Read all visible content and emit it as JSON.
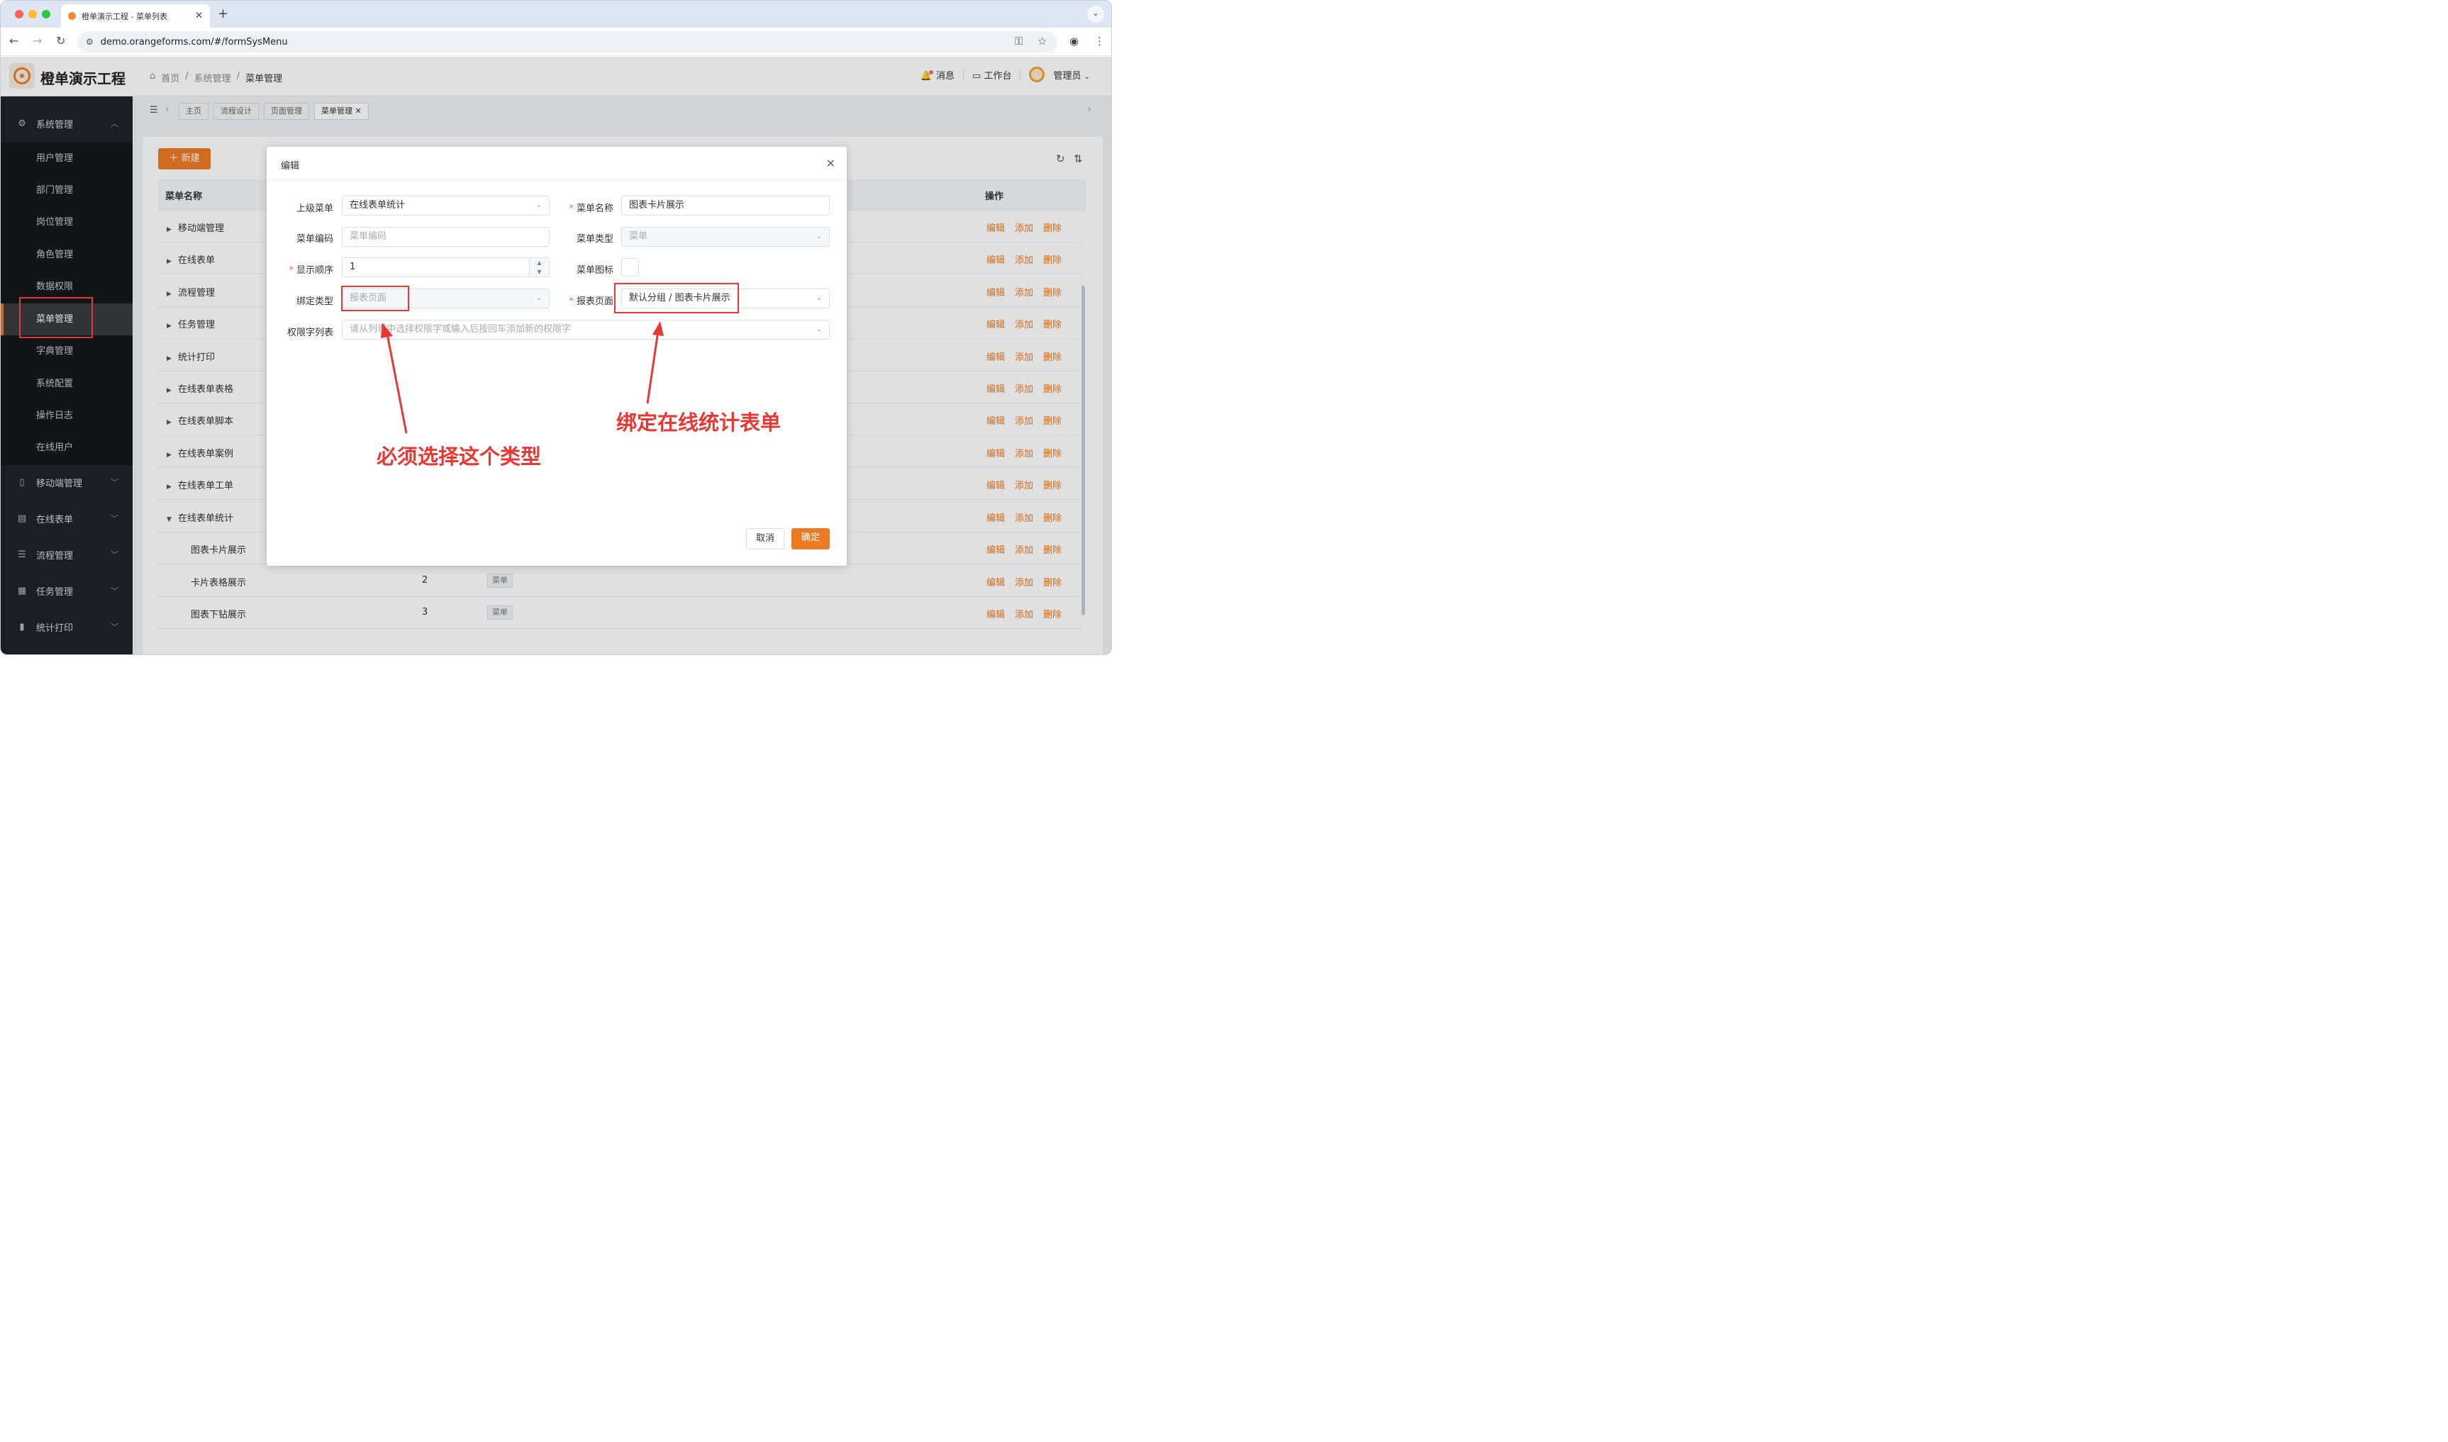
{
  "browser": {
    "tab_title": "橙单演示工程 - 菜单列表",
    "new_tab": "+",
    "url": "demo.orangeforms.com/#/formSysMenu",
    "traffic_colors": [
      "#ff5f57",
      "#febc2e",
      "#28c840"
    ]
  },
  "header": {
    "app_name": "橙单演示工程",
    "breadcrumb": [
      "首页",
      "/",
      "系统管理",
      "/",
      "菜单管理"
    ],
    "notifications": "消息",
    "workbench": "工作台",
    "user": "管理员"
  },
  "sidebar": {
    "system": "系统管理",
    "submenu": [
      "用户管理",
      "部门管理",
      "岗位管理",
      "角色管理",
      "数据权限",
      "菜单管理",
      "字典管理",
      "系统配置",
      "操作日志",
      "在线用户"
    ],
    "active_item": "菜单管理",
    "groups": [
      "移动端管理",
      "在线表单",
      "流程管理",
      "任务管理",
      "统计打印"
    ]
  },
  "tags": [
    "主页",
    "流程设计",
    "页面管理",
    "菜单管理"
  ],
  "toolbar": {
    "new_button": "新建"
  },
  "table": {
    "columns": {
      "name": "菜单名称",
      "actions": "操作"
    },
    "actions": [
      "编辑",
      "添加",
      "删除"
    ],
    "rows": [
      {
        "name": "移动端管理",
        "arrow": "▶"
      },
      {
        "name": "在线表单",
        "arrow": "▶"
      },
      {
        "name": "流程管理",
        "arrow": "▶"
      },
      {
        "name": "任务管理",
        "arrow": "▶"
      },
      {
        "name": "统计打印",
        "arrow": "▶"
      },
      {
        "name": "在线表单表格",
        "arrow": "▶"
      },
      {
        "name": "在线表单脚本",
        "arrow": "▶"
      },
      {
        "name": "在线表单案例",
        "arrow": "▶"
      },
      {
        "name": "在线表单工单",
        "arrow": "▶"
      },
      {
        "name": "在线表单统计",
        "arrow": "▼"
      },
      {
        "name": "图表卡片展示",
        "order": "",
        "type": ""
      },
      {
        "name": "卡片表格展示",
        "order": "2",
        "type": "菜单"
      },
      {
        "name": "图表下钻展示",
        "order": "3",
        "type": "菜单"
      }
    ]
  },
  "dialog": {
    "title": "编辑",
    "close": "✕",
    "fields": {
      "parent_label": "上级菜单",
      "parent_value": "在线表单统计",
      "name_label": "菜单名称",
      "name_value": "图表卡片展示",
      "code_label": "菜单编码",
      "code_placeholder": "菜单编码",
      "type_label": "菜单类型",
      "type_value": "菜单",
      "order_label": "显示顺序",
      "order_value": "1",
      "icon_label": "菜单图标",
      "bind_label": "绑定类型",
      "bind_value": "报表页面",
      "report_label": "报表页面",
      "report_value": "默认分组 / 图表卡片展示",
      "perm_label": "权限字列表",
      "perm_placeholder": "请从列表中选择权限字或输入后按回车添加新的权限字"
    },
    "cancel": "取消",
    "confirm": "确定"
  },
  "annotations": {
    "left": "必须选择这个类型",
    "right": "绑定在线统计表单",
    "color": "#e53935"
  },
  "colors": {
    "accent": "#ec7c24",
    "sidebar": "#1f2329"
  }
}
